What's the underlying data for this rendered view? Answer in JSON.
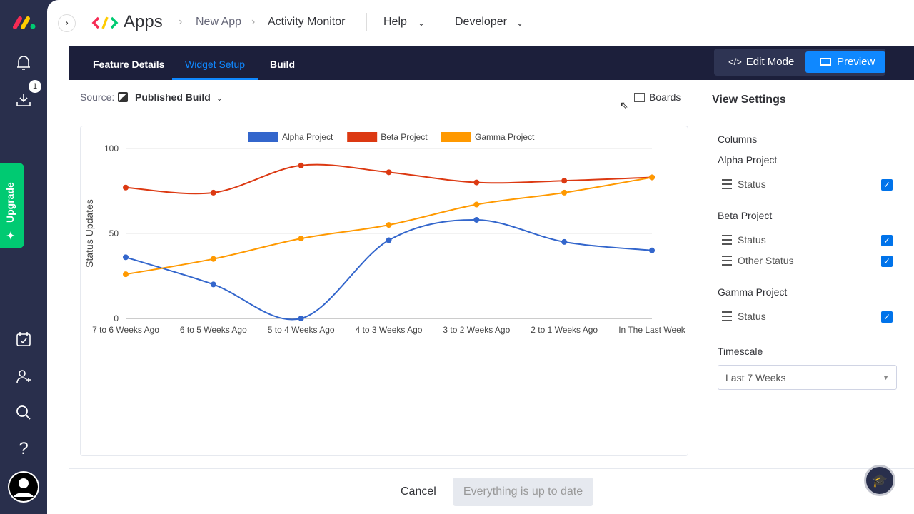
{
  "sidebar": {
    "badge": "1",
    "upgrade": "Upgrade"
  },
  "header": {
    "app": "Apps",
    "crumbs": [
      "New App",
      "Activity Monitor"
    ],
    "menus": [
      "Help",
      "Developer"
    ]
  },
  "tabs": [
    "Feature Details",
    "Widget Setup",
    "Build"
  ],
  "modes": {
    "edit": "Edit Mode",
    "preview": "Preview"
  },
  "source": {
    "label": "Source:",
    "value": "Published Build",
    "boards": "Boards"
  },
  "settings": {
    "title": "View Settings",
    "columns": "Columns",
    "groups": [
      {
        "name": "Alpha Project",
        "cols": [
          "Status"
        ]
      },
      {
        "name": "Beta Project",
        "cols": [
          "Status",
          "Other Status"
        ]
      },
      {
        "name": "Gamma Project",
        "cols": [
          "Status"
        ]
      }
    ],
    "timescale_label": "Timescale",
    "timescale": "Last 7 Weeks"
  },
  "footer": {
    "cancel": "Cancel",
    "status": "Everything is up to date"
  },
  "chart_data": {
    "type": "line",
    "ylabel": "Status Updates",
    "ylim": [
      0,
      100
    ],
    "yticks": [
      "0",
      "50",
      "100"
    ],
    "grid": true,
    "legend": "top",
    "categories": [
      "7 to 6 Weeks Ago",
      "6 to 5 Weeks Ago",
      "5 to 4 Weeks Ago",
      "4 to 3 Weeks Ago",
      "3 to 2 Weeks Ago",
      "2 to 1 Weeks Ago",
      "In The Last Week"
    ],
    "series": [
      {
        "name": "Alpha Project",
        "color": "#3366cc",
        "values": [
          36,
          20,
          0,
          46,
          58,
          45,
          40
        ]
      },
      {
        "name": "Beta Project",
        "color": "#dc3912",
        "values": [
          77,
          74,
          90,
          86,
          80,
          81,
          83
        ]
      },
      {
        "name": "Gamma Project",
        "color": "#ff9900",
        "values": [
          26,
          35,
          47,
          55,
          67,
          74,
          83
        ]
      }
    ]
  }
}
